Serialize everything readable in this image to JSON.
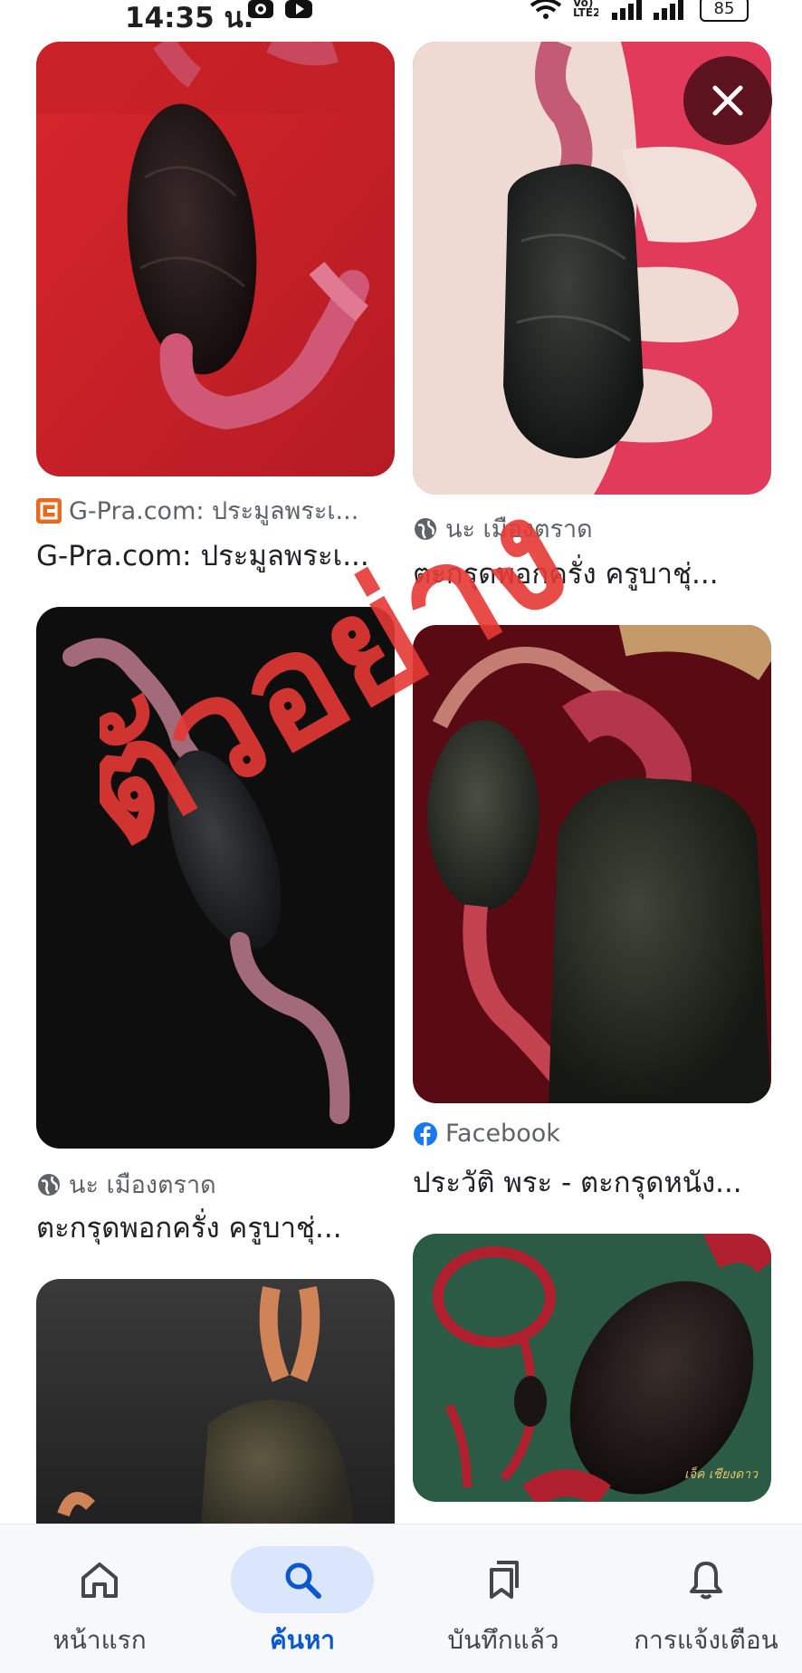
{
  "status_bar": {
    "time": "14:35 น.",
    "network": "Vo) LTE2",
    "battery": "85"
  },
  "results": [
    {
      "source": "G-Pra.com: ประมูลพระเ...",
      "title": "G-Pra.com: ประมูลพระเ..."
    },
    {
      "source": "นะ เมืองตราด",
      "title": "ตะกรุดพอกครั่ง ครูบาชุ่..."
    },
    {
      "source": "นะ เมืองตราด",
      "title": "ตะกรุดพอกครั่ง ครูบาชุ่..."
    },
    {
      "source": "Facebook",
      "title": "ประวัติ พระ - ตะกรุดหนัง..."
    }
  ],
  "image_caption": "เจ็ค เชียงดาว",
  "watermark_text": "ตัวอย่าง",
  "nav": [
    {
      "label": "หน้าแรก",
      "icon": "home-icon"
    },
    {
      "label": "ค้นหา",
      "icon": "search-icon",
      "active": true
    },
    {
      "label": "บันทึกแล้ว",
      "icon": "bookmark-icon"
    },
    {
      "label": "การแจ้งเตือน",
      "icon": "bell-icon"
    }
  ],
  "colors": {
    "accent": "#0b57d0",
    "active_pill": "#d9e6fb",
    "close_button": "#5e1320",
    "watermark": "#e53935"
  }
}
